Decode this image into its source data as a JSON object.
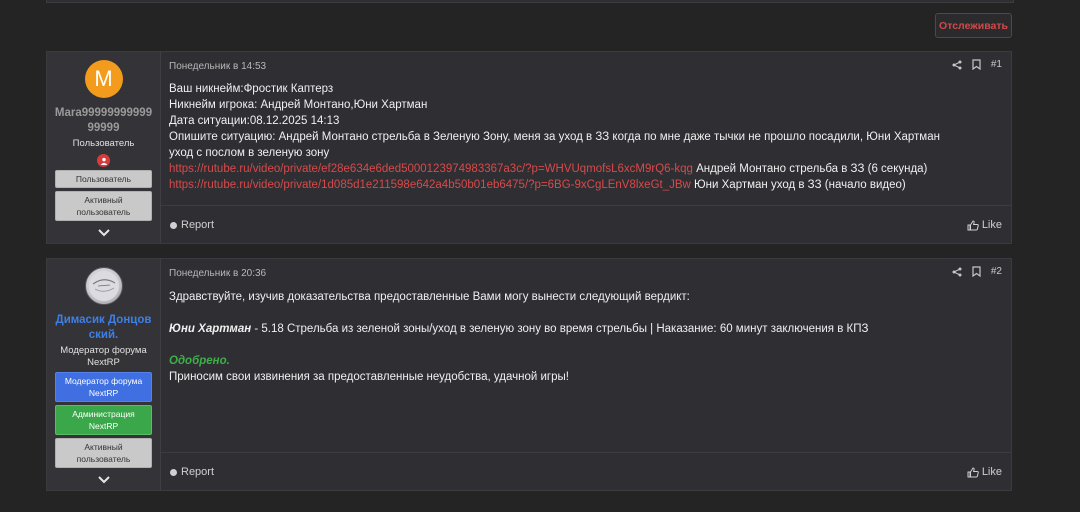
{
  "header": {
    "follow_label": "Отслеживать"
  },
  "posts": [
    {
      "avatar_letter": "M",
      "username": "Mara9999999999999999",
      "user_title": "Пользователь",
      "badges": [
        "Пользователь",
        "Активный пользователь"
      ],
      "date": "Понедельник в 14:53",
      "number": "#1",
      "lines": [
        "Ваш никнейм:Фростик Каптерз",
        "Никнейм игрока: Андрей Монтано,Юни Хартман",
        "Дата ситуации:08.12.2025 14:13",
        "Опишите ситуацию: Андрей Монтано стрельба в Зеленую Зону, меня за уход в ЗЗ когда по мне даже тычки не прошло посадили, Юни Хартман уход с послом в зеленую зону"
      ],
      "link1": "https://rutube.ru/video/private/ef28e634e6ded5000123974983367a3c/?p=WHVUqmofsL6xcM9rQ6-kqg",
      "link1_desc": " Андрей Монтано стрельба в ЗЗ (6 секунда)",
      "link2": "https://rutube.ru/video/private/1d085d1e211598e642a4b50b01eb6475/?p=6BG-9xCgLEnV8lxeGt_JBw",
      "link2_desc": " Юни Хартман уход в ЗЗ (начало видео)",
      "report": "Report",
      "like": "Like"
    },
    {
      "username": "Димасик Донцовский.",
      "user_title": "Модератор форума NextRP",
      "badges": [
        "Модератор форума NextRP",
        "Администрация NextRP",
        "Активный пользователь"
      ],
      "date": "Понедельник в 20:36",
      "number": "#2",
      "intro": "Здравствуйте, изучив доказательства предоставленные Вами могу вынести следующий вердикт:",
      "verdict_name": "Юни Хартман",
      "verdict_text": " - 5.18 Стрельба из зеленой зоны/уход в зеленую зону во время стрельбы | Наказание: 60 минут заключения в КПЗ",
      "status": "Одобрено.",
      "closing": "Приносим свои извинения за предоставленные неудобства, удачной игры!",
      "report": "Report",
      "like": "Like"
    }
  ],
  "colors": {
    "accent_red": "#d84a4a",
    "approved_green": "#3fae4a",
    "moderator_blue": "#3e7fe6"
  }
}
